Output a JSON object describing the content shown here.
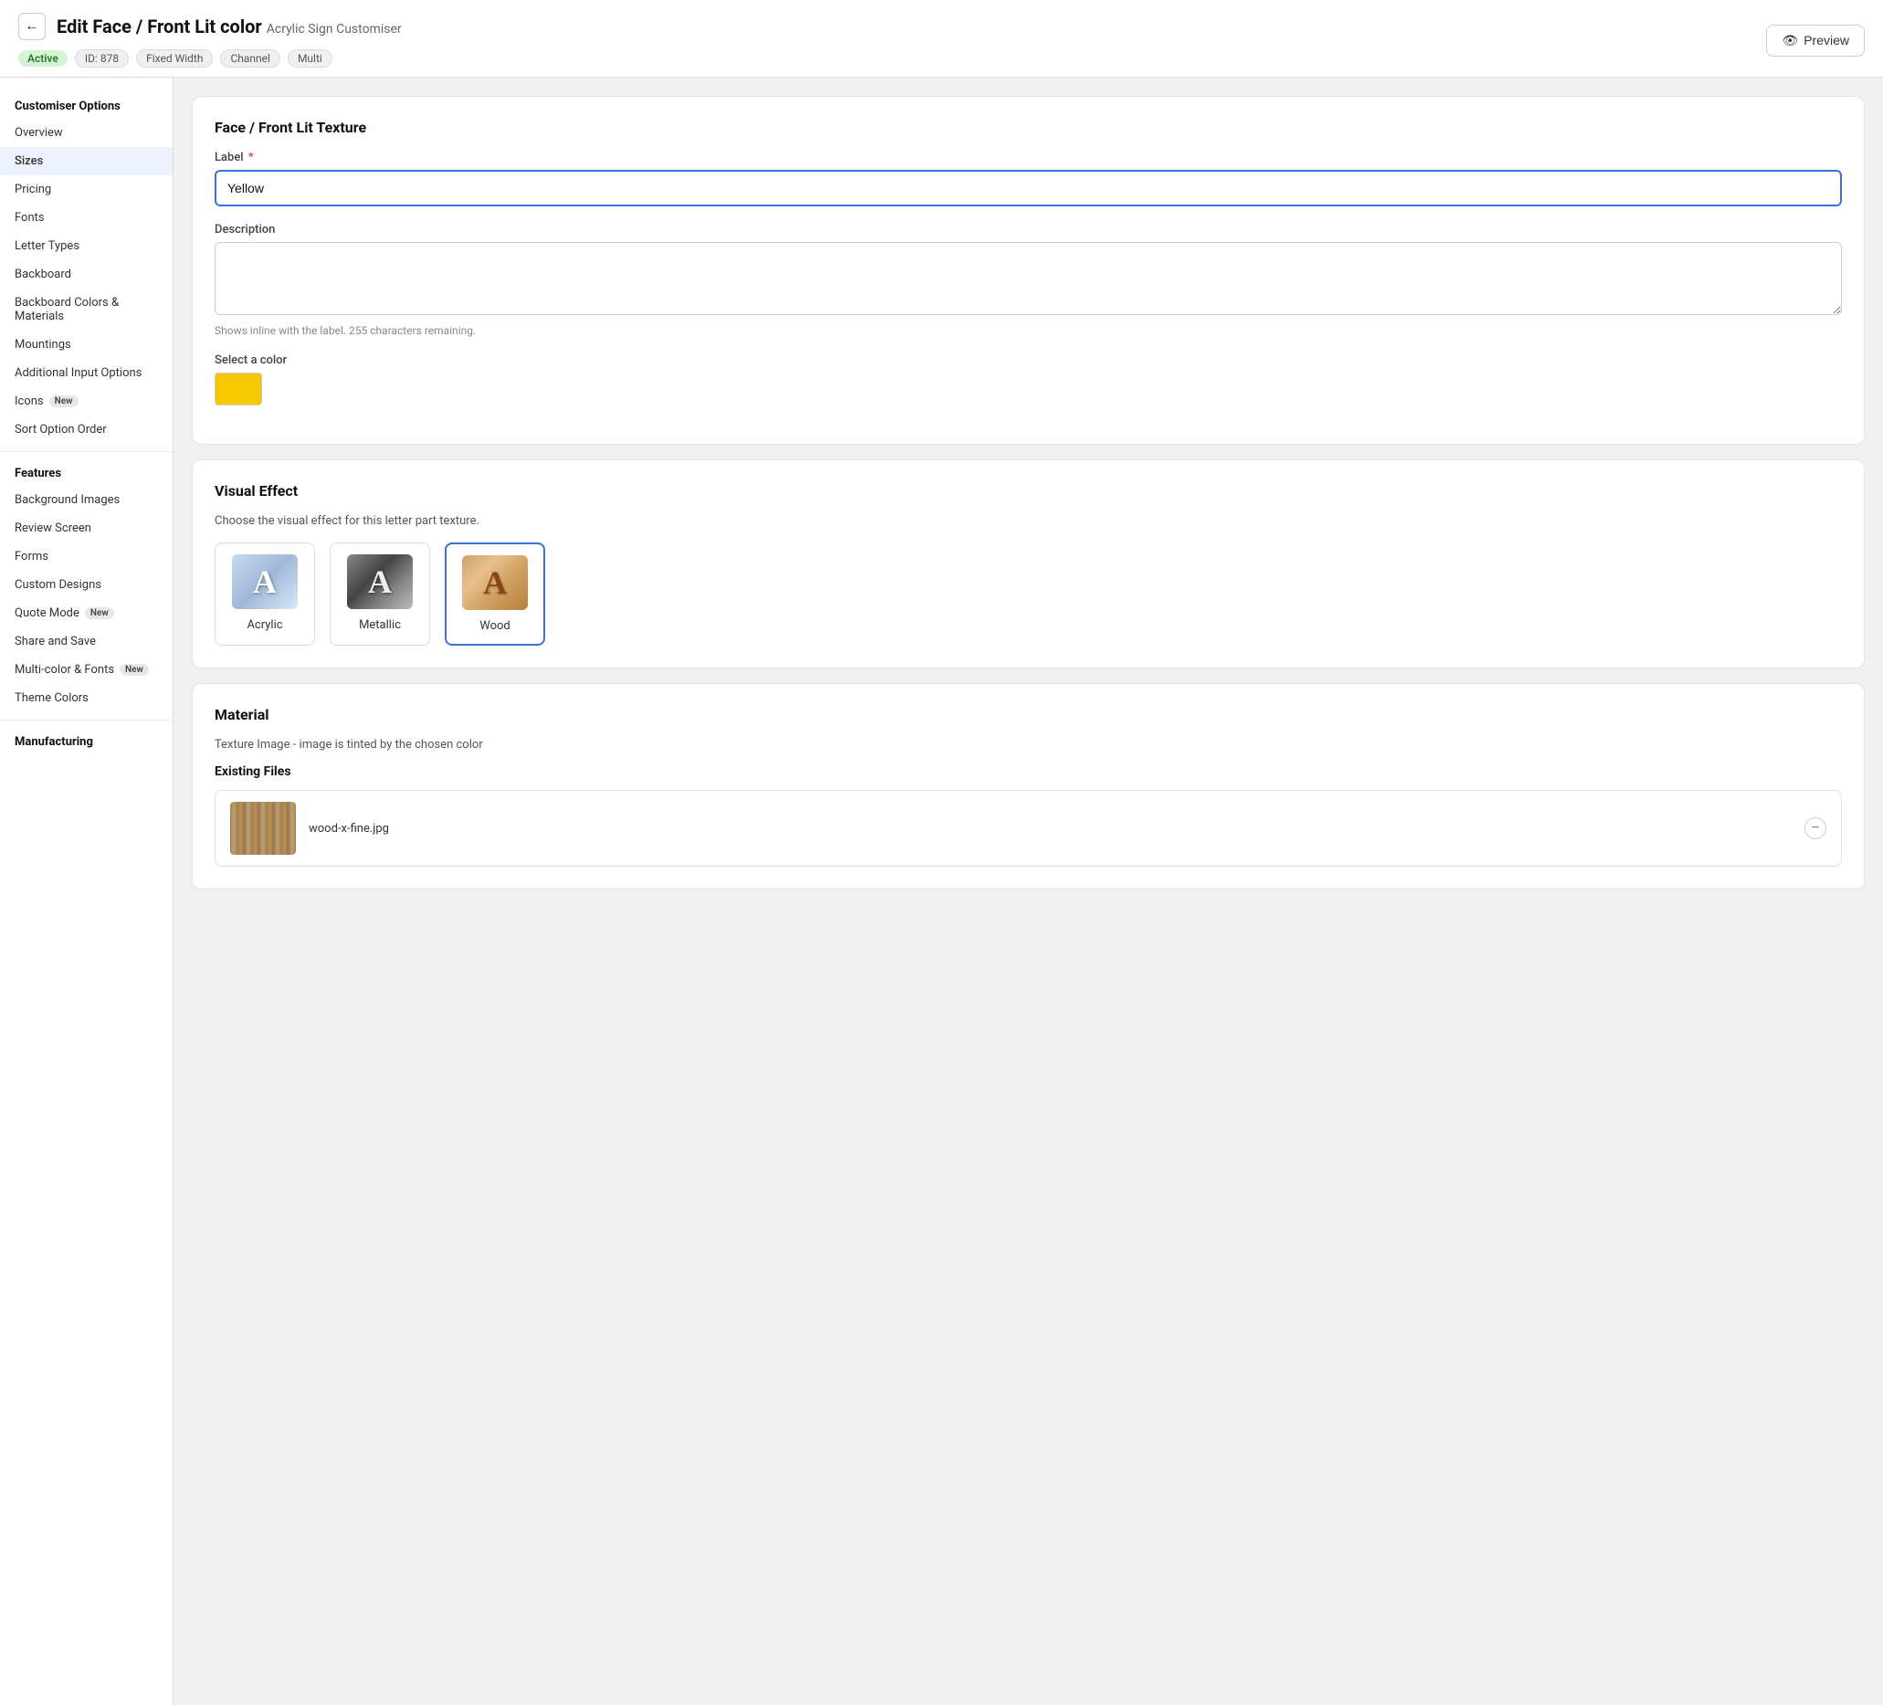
{
  "header": {
    "back_label": "←",
    "title": "Edit Face / Front Lit color",
    "subtitle": "Acrylic Sign Customiser",
    "tags": {
      "active": "Active",
      "id": "ID: 878",
      "fixed_width": "Fixed Width",
      "channel": "Channel",
      "multi": "Multi"
    },
    "preview_btn": "Preview"
  },
  "sidebar": {
    "customiser_options_title": "Customiser Options",
    "items_top": [
      {
        "label": "Overview",
        "active": false
      },
      {
        "label": "Sizes",
        "active": false
      },
      {
        "label": "Pricing",
        "active": false
      },
      {
        "label": "Fonts",
        "active": false
      },
      {
        "label": "Letter Types",
        "active": false
      },
      {
        "label": "Backboard",
        "active": false
      },
      {
        "label": "Backboard Colors & Materials",
        "active": false
      },
      {
        "label": "Mountings",
        "active": false
      },
      {
        "label": "Additional Input Options",
        "active": false
      },
      {
        "label": "Icons",
        "active": false,
        "badge": "New"
      },
      {
        "label": "Sort Option Order",
        "active": false
      }
    ],
    "features_title": "Features",
    "items_features": [
      {
        "label": "Background Images",
        "active": false
      },
      {
        "label": "Review Screen",
        "active": false
      },
      {
        "label": "Forms",
        "active": false
      },
      {
        "label": "Custom Designs",
        "active": false
      },
      {
        "label": "Quote Mode",
        "active": false,
        "badge": "New"
      },
      {
        "label": "Share and Save",
        "active": false
      },
      {
        "label": "Multi-color & Fonts",
        "active": false,
        "badge": "New"
      },
      {
        "label": "Theme Colors",
        "active": false
      }
    ],
    "manufacturing_title": "Manufacturing"
  },
  "main": {
    "face_texture_card": {
      "title": "Face / Front Lit Texture",
      "label_field": {
        "label": "Label",
        "required": true,
        "value": "Yellow"
      },
      "description_field": {
        "label": "Description",
        "value": "",
        "hint": "Shows inline with the label. 255 characters remaining."
      },
      "color_field": {
        "label": "Select a color",
        "color": "#f5c800"
      }
    },
    "visual_effect_card": {
      "title": "Visual Effect",
      "description": "Choose the visual effect for this letter part texture.",
      "options": [
        {
          "label": "Acrylic",
          "selected": false
        },
        {
          "label": "Metallic",
          "selected": false
        },
        {
          "label": "Wood",
          "selected": true
        }
      ]
    },
    "material_card": {
      "title": "Material",
      "description": "Texture Image - image is tinted by the chosen color",
      "existing_files_title": "Existing Files",
      "files": [
        {
          "name": "wood-x-fine.jpg"
        }
      ]
    }
  }
}
